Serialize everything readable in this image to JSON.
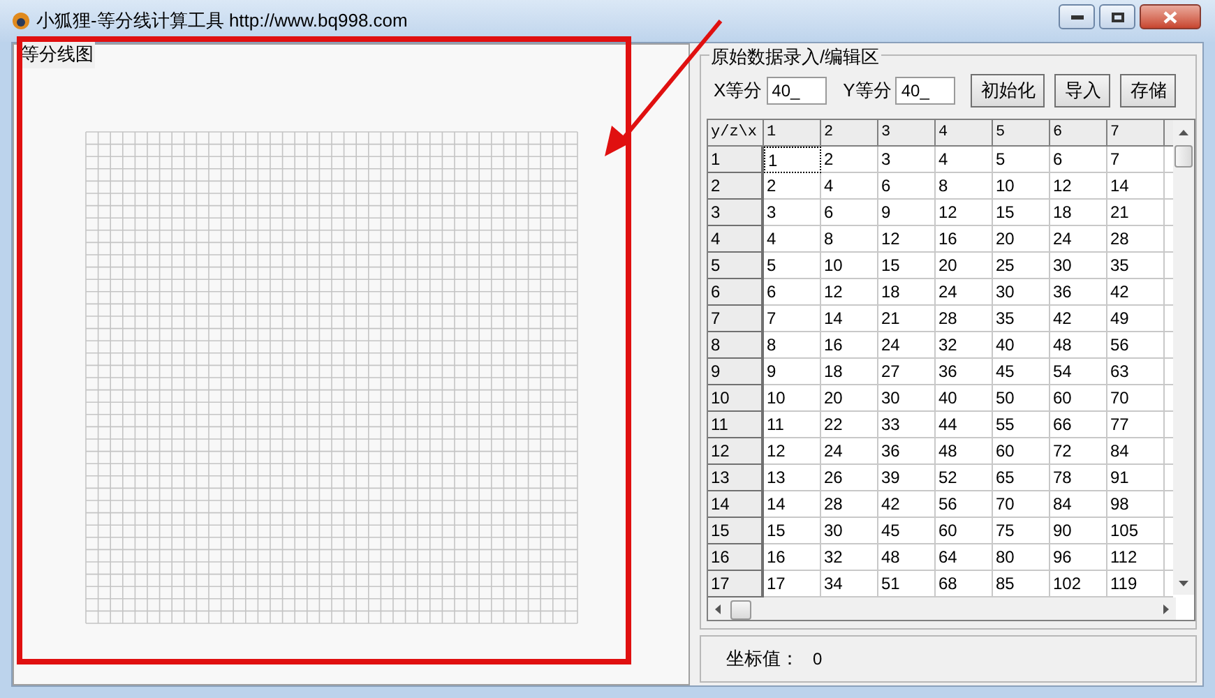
{
  "window": {
    "title": "小狐狸-等分线计算工具 http://www.bq998.com"
  },
  "chart_panel": {
    "title": "等分线图"
  },
  "data_panel": {
    "title": "原始数据录入/编辑区",
    "x_divisions": {
      "label": "X等分",
      "value": "40_"
    },
    "y_divisions": {
      "label": "Y等分",
      "value": "40_"
    },
    "buttons": [
      "初始化",
      "导入",
      "存储"
    ]
  },
  "table": {
    "columns": [
      "y/z\\x",
      "1",
      "2",
      "3",
      "4",
      "5",
      "6",
      "7"
    ],
    "rows": [
      {
        "selected": true,
        "cells": [
          "1",
          "1",
          "2",
          "3",
          "4",
          "5",
          "6",
          "7"
        ]
      },
      {
        "selected": false,
        "cells": [
          "2",
          "2",
          "4",
          "6",
          "8",
          "10",
          "12",
          "14"
        ]
      },
      {
        "selected": false,
        "cells": [
          "3",
          "3",
          "6",
          "9",
          "12",
          "15",
          "18",
          "21"
        ]
      },
      {
        "selected": false,
        "cells": [
          "4",
          "4",
          "8",
          "12",
          "16",
          "20",
          "24",
          "28"
        ]
      },
      {
        "selected": false,
        "cells": [
          "5",
          "5",
          "10",
          "15",
          "20",
          "25",
          "30",
          "35"
        ]
      },
      {
        "selected": false,
        "cells": [
          "6",
          "6",
          "12",
          "18",
          "24",
          "30",
          "36",
          "42"
        ]
      },
      {
        "selected": false,
        "cells": [
          "7",
          "7",
          "14",
          "21",
          "28",
          "35",
          "42",
          "49"
        ]
      },
      {
        "selected": false,
        "cells": [
          "8",
          "8",
          "16",
          "24",
          "32",
          "40",
          "48",
          "56"
        ]
      },
      {
        "selected": false,
        "cells": [
          "9",
          "9",
          "18",
          "27",
          "36",
          "45",
          "54",
          "63"
        ]
      },
      {
        "selected": false,
        "cells": [
          "10",
          "10",
          "20",
          "30",
          "40",
          "50",
          "60",
          "70"
        ]
      },
      {
        "selected": false,
        "cells": [
          "11",
          "11",
          "22",
          "33",
          "44",
          "55",
          "66",
          "77"
        ]
      },
      {
        "selected": false,
        "cells": [
          "12",
          "12",
          "24",
          "36",
          "48",
          "60",
          "72",
          "84"
        ]
      },
      {
        "selected": false,
        "cells": [
          "13",
          "13",
          "26",
          "39",
          "52",
          "65",
          "78",
          "91"
        ]
      },
      {
        "selected": false,
        "cells": [
          "14",
          "14",
          "28",
          "42",
          "56",
          "70",
          "84",
          "98"
        ]
      },
      {
        "selected": false,
        "cells": [
          "15",
          "15",
          "30",
          "45",
          "60",
          "75",
          "90",
          "105"
        ]
      },
      {
        "selected": false,
        "cells": [
          "16",
          "16",
          "32",
          "48",
          "64",
          "80",
          "96",
          "112"
        ]
      },
      {
        "selected": false,
        "cells": [
          "17",
          "17",
          "34",
          "51",
          "68",
          "85",
          "102",
          "119"
        ]
      }
    ]
  },
  "status": {
    "label": "坐标值：",
    "value": "0"
  }
}
